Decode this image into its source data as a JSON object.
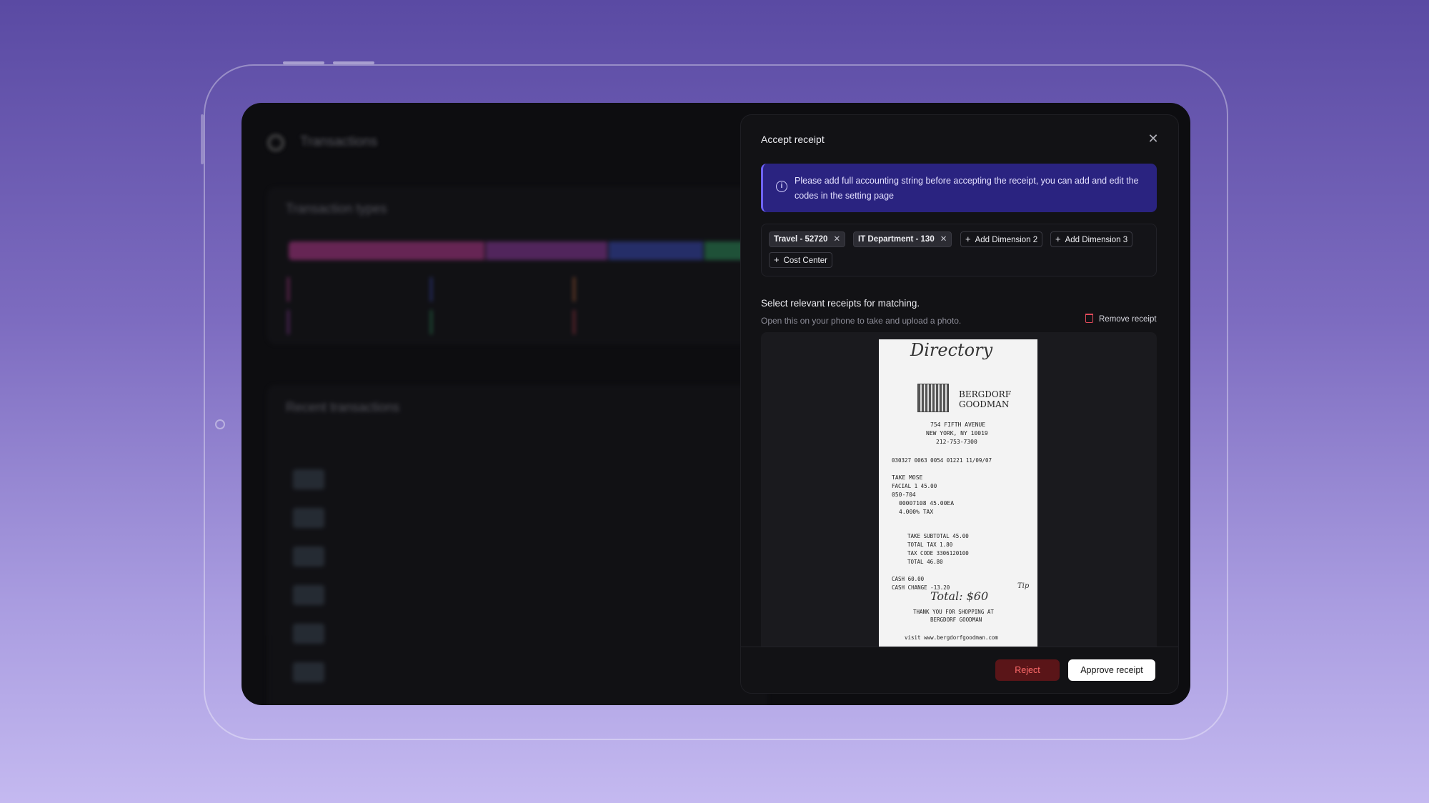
{
  "background_app": {
    "title": "Transactions",
    "section1_title": "Transaction types",
    "section2_title": "Recent transactions"
  },
  "modal": {
    "title": "Accept receipt",
    "info_text": "Please add full accounting string before accepting the receipt, you can add and edit the codes in the setting page",
    "tags": [
      {
        "label": "Travel - 52720"
      },
      {
        "label": "IT Department - 130"
      }
    ],
    "add_buttons": [
      {
        "label": "Add Dimension 2"
      },
      {
        "label": "Add Dimension 3"
      },
      {
        "label": "Cost Center"
      }
    ],
    "section_title": "Select relevant receipts for matching.",
    "section_subtitle": "Open this on your phone to take and upload a photo.",
    "remove_label": "Remove receipt",
    "receipt": {
      "handwritten_top": "Directory",
      "store_name_1": "BERGDORF",
      "store_name_2": "GOODMAN",
      "address_1": "754 FIFTH AVENUE",
      "address_2": "NEW YORK, NY 10019",
      "phone": "212-753-7300",
      "ids": "030327  0063  0054  01221  11/09/07",
      "line_1": "TAKE MOSE",
      "line_2": "FACIAL         1          45.00",
      "line_3": "050-704",
      "line_4": "00007108         45.00EA",
      "line_5": "4.000% TAX",
      "subtotal": "TAKE SUBTOTAL             45.00",
      "total_tax": "TOTAL TAX                  1.80",
      "tax_code": "TAX CODE  3306120100",
      "total": "TOTAL                     46.80",
      "cash": "CASH                      60.00",
      "cash_change": "CASH CHANGE              -13.20",
      "handwritten_total": "Total: $60",
      "handwritten_tip": "Tip",
      "thanks_1": "THANK YOU FOR SHOPPING AT",
      "thanks_2": "BERGDORF GOODMAN",
      "visit": "visit  www.bergdorfgoodman.com"
    },
    "reject_label": "Reject",
    "approve_label": "Approve receipt"
  }
}
